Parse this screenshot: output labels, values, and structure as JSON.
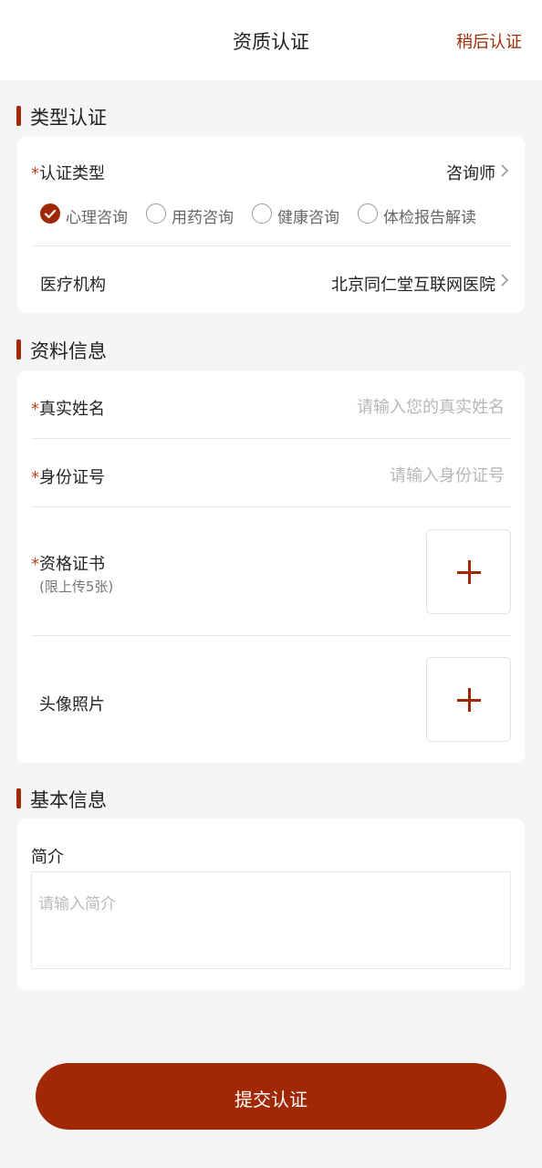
{
  "header": {
    "title": "资质认证",
    "later_label": "稍后认证"
  },
  "sections": {
    "type": {
      "title": "类型认证",
      "cert_type_label": "认证类型",
      "cert_type_value": "咨询师",
      "options": [
        {
          "label": "心理咨询",
          "checked": true
        },
        {
          "label": "用药咨询",
          "checked": false
        },
        {
          "label": "健康咨询",
          "checked": false
        },
        {
          "label": "体检报告解读",
          "checked": false
        }
      ],
      "institution_label": "医疗机构",
      "institution_value": "北京同仁堂互联网医院"
    },
    "profile": {
      "title": "资料信息",
      "name_label": "真实姓名",
      "name_placeholder": "请输入您的真实姓名",
      "id_label": "身份证号",
      "id_placeholder": "请输入身份证号",
      "cert_label": "资格证书",
      "cert_hint": "(限上传5张)",
      "avatar_label": "头像照片"
    },
    "basic": {
      "title": "基本信息",
      "intro_label": "简介",
      "intro_placeholder": "请输入简介"
    }
  },
  "required_mark": "*",
  "submit_label": "提交认证",
  "colors": {
    "accent": "#a02805",
    "background": "#f5f5f5",
    "card": "#ffffff",
    "placeholder": "#b7b7b7"
  },
  "icons": {
    "chevron": "chevron-right-icon",
    "check": "checkmark-icon",
    "plus": "plus-icon"
  }
}
